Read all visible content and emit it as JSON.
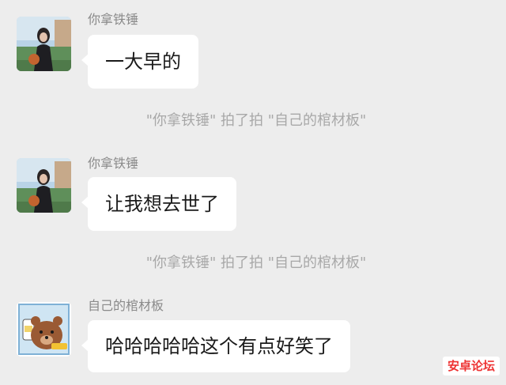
{
  "messages": [
    {
      "sender": "你拿铁锤",
      "text": "一大早的"
    },
    {
      "sender": "你拿铁锤",
      "text": "让我想去世了"
    },
    {
      "sender": "自己的棺材板",
      "text": "哈哈哈哈哈这个有点好笑了"
    }
  ],
  "system_notices": [
    "\"你拿铁锤\" 拍了拍 \"自己的棺材板\"",
    "\"你拿铁锤\" 拍了拍 \"自己的棺材板\""
  ],
  "watermark": "安卓论坛",
  "colors": {
    "background": "#ededed",
    "bubble": "#ffffff",
    "sender_text": "#8a8a8a",
    "system_text": "#a8a8a8",
    "watermark": "#e33333"
  }
}
